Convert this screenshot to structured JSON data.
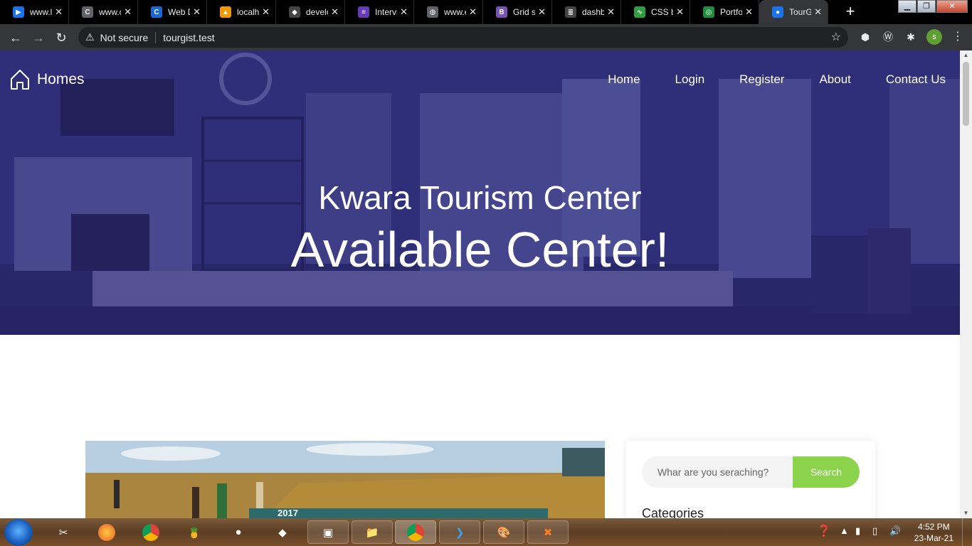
{
  "browser": {
    "tabs": [
      {
        "title": "www.l",
        "fav_color": "#1a73e8",
        "fav_glyph": "▶"
      },
      {
        "title": "www.c",
        "fav_color": "#5f6368",
        "fav_glyph": "C"
      },
      {
        "title": "Web D",
        "fav_color": "#1967d2",
        "fav_glyph": "C"
      },
      {
        "title": "localh",
        "fav_color": "#f29900",
        "fav_glyph": "▲"
      },
      {
        "title": "develo",
        "fav_color": "#444444",
        "fav_glyph": "◆"
      },
      {
        "title": "Intervi",
        "fav_color": "#673ab7",
        "fav_glyph": "≡"
      },
      {
        "title": "www.e",
        "fav_color": "#5f6368",
        "fav_glyph": "◍"
      },
      {
        "title": "Grid s",
        "fav_color": "#7952b3",
        "fav_glyph": "B"
      },
      {
        "title": "dashb",
        "fav_color": "#444444",
        "fav_glyph": "≣"
      },
      {
        "title": "CSS b",
        "fav_color": "#2e9e3e",
        "fav_glyph": "∿"
      },
      {
        "title": "Portfo",
        "fav_color": "#1e8e3e",
        "fav_glyph": "◎"
      },
      {
        "title": "TourG",
        "fav_color": "#1a73e8",
        "fav_glyph": "●"
      }
    ],
    "active_tab": 11,
    "new_tab_label": "+",
    "security_label": "Not secure",
    "url": "tourgist.test",
    "profile_initial": "s"
  },
  "site": {
    "brand": "Homes",
    "nav": [
      "Home",
      "Login",
      "Register",
      "About",
      "Contact Us"
    ],
    "hero_subtitle": "Kwara Tourism Center",
    "hero_title": "Available Center!",
    "search": {
      "placeholder": "Whar are you seraching?",
      "button_label": "Search"
    },
    "categories_heading": "Categories",
    "feature_image_caption": "2017"
  },
  "taskbar": {
    "time": "4:52 PM",
    "date": "23-Mar-21",
    "apps": [
      "paint-icon",
      "firefox-icon",
      "chrome-icon",
      "fruit-icon",
      "gimp-icon",
      "stone-icon",
      "virtualbox-icon",
      "explorer-icon",
      "chrome-icon",
      "vscode-icon",
      "paint-palette-icon",
      "xampp-icon"
    ]
  }
}
